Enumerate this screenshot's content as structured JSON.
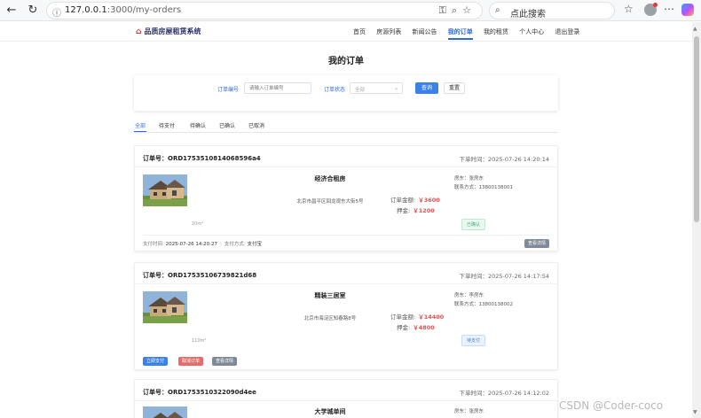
{
  "browser": {
    "url_host": "127.0.0.1",
    "url_path": ":3000/my-orders",
    "search_placeholder": "点此搜索"
  },
  "site": {
    "logo_text": "品质房屋租赁系统",
    "menu": [
      "首页",
      "房源列表",
      "新闻公告",
      "我的订单",
      "我的租赁",
      "个人中心",
      "退出登录"
    ],
    "active_menu": "我的订单"
  },
  "page": {
    "title": "我的订单"
  },
  "filter": {
    "order_no_label": "订单编号",
    "order_no_placeholder": "请输入订单编号",
    "status_label": "订单状态",
    "status_value": "全部",
    "query_label": "查询",
    "reset_label": "重置"
  },
  "tabs": [
    "全部",
    "待支付",
    "待确认",
    "已确认",
    "已取消"
  ],
  "orders": [
    {
      "order_no": "订单号：ORD1753510814068596a4",
      "time": "下单时间：2025-07-26 14:20:14",
      "house_title": "经济合租房",
      "address": "北京市昌平区回龙观东大街5号",
      "area": "20m²",
      "landlord": "房东：张房东",
      "contact": "联系方式：13800138001",
      "amount_label": "订单金额:",
      "amount": "￥3600",
      "deposit_label": "押金:",
      "deposit": "￥1200",
      "status": "已确认",
      "pay_time_label": "支付时间:",
      "pay_time": "2025-07-26 14:20:27",
      "pay_method_label": "支付方式:",
      "pay_method": "支付宝",
      "detail_label": "查看详情"
    },
    {
      "order_no": "订单号：ORD17535106739821d68",
      "time": "下单时间：2025-07-26 14:17:54",
      "house_title": "精装三居室",
      "address": "北京市海淀区知春路8号",
      "area": "110m²",
      "landlord": "房东：李房东",
      "contact": "联系方式：13800138002",
      "amount_label": "订单金额:",
      "amount": "￥14400",
      "deposit_label": "押金:",
      "deposit": "￥4800",
      "status": "待支付",
      "pay_label": "立即支付",
      "cancel_label": "取消订单",
      "detail_label": "查看详情"
    },
    {
      "order_no": "订单号：ORD1753510322090d4ee",
      "time": "下单时间：2025-07-26 14:12:02",
      "house_title": "大学城单间",
      "landlord": "房东：张房东"
    }
  ],
  "watermark": "CSDN @Coder-coco"
}
